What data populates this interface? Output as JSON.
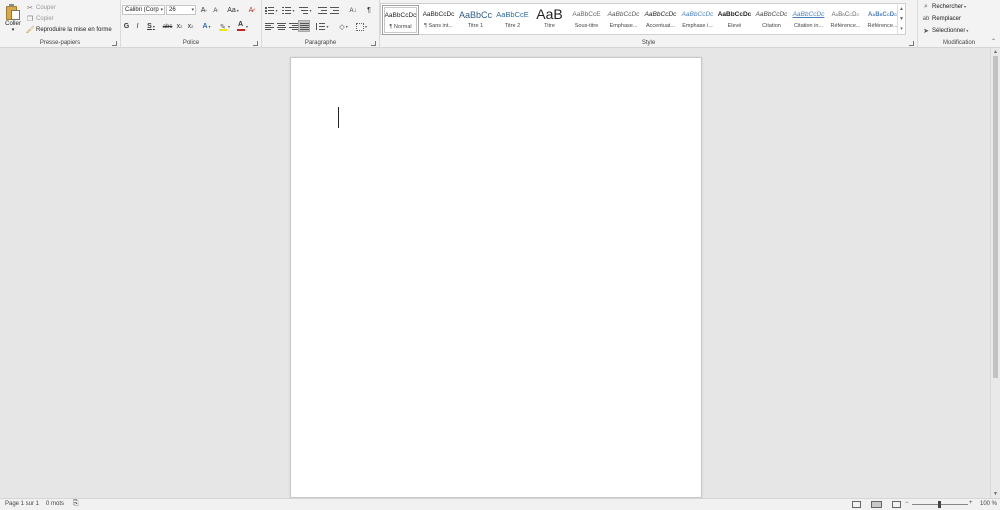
{
  "clipboard": {
    "paste_label": "Coller",
    "cut_label": "Couper",
    "copy_label": "Copier",
    "format_painter_label": "Reproduire la mise en forme",
    "group_label": "Presse-papiers"
  },
  "font": {
    "font_name": "Calibri (Corp",
    "font_size": "26",
    "grow_label": "A",
    "shrink_label": "A",
    "case_label": "Aa",
    "bold": "G",
    "italic": "I",
    "underline": "S",
    "strike": "abc",
    "subscript": "x",
    "superscript": "x",
    "text_effects": "A",
    "highlight_color": "#f5e600",
    "font_color": "#c8231d",
    "group_label": "Police"
  },
  "paragraph": {
    "group_label": "Paragraphe",
    "pilcrow": "¶"
  },
  "styles": {
    "group_label": "Style",
    "items": [
      {
        "sample": "AaBbCcDc",
        "name": "¶ Normal",
        "selected": true
      },
      {
        "sample": "AaBbCcDc",
        "name": "¶ Sans int..."
      },
      {
        "sample": "AaBbCc",
        "name": "Titre 1"
      },
      {
        "sample": "AaBbCcE",
        "name": "Titre 2"
      },
      {
        "sample": "AaB",
        "name": "Titre"
      },
      {
        "sample": "AaBbCcE",
        "name": "Sous-titre"
      },
      {
        "sample": "AaBbCcDc",
        "name": "Emphase..."
      },
      {
        "sample": "AaBbCcDc",
        "name": "Accentuat..."
      },
      {
        "sample": "AaBbCcDc",
        "name": "Emphase i..."
      },
      {
        "sample": "AaBbCcDc",
        "name": "Élevé"
      },
      {
        "sample": "AaBbCcDc",
        "name": "Citation"
      },
      {
        "sample": "AaBbCcDc",
        "name": "Citation in..."
      },
      {
        "sample": "AaBbCcDc",
        "name": "Référence..."
      },
      {
        "sample": "AaBbCcDc",
        "name": "Référence..."
      }
    ]
  },
  "editing": {
    "find_label": "Rechercher",
    "replace_label": "Remplacer",
    "select_label": "Sélectionner",
    "group_label": "Modification"
  },
  "status": {
    "page": "Page 1 sur 1",
    "words": "0 mots",
    "zoom": "100 %"
  }
}
